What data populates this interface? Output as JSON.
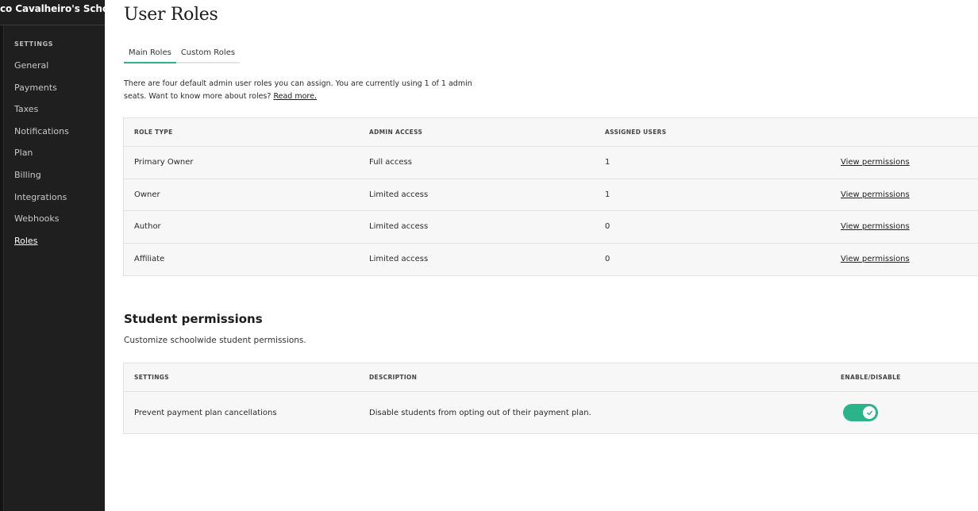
{
  "sidebar": {
    "school_name": "co Cavalheiro's School",
    "section_label": "SETTINGS",
    "items": [
      {
        "label": "General"
      },
      {
        "label": "Payments"
      },
      {
        "label": "Taxes"
      },
      {
        "label": "Notifications"
      },
      {
        "label": "Plan"
      },
      {
        "label": "Billing"
      },
      {
        "label": "Integrations"
      },
      {
        "label": "Webhooks"
      },
      {
        "label": "Roles"
      }
    ],
    "active_item": "Roles"
  },
  "main": {
    "title": "User Roles",
    "tabs": [
      {
        "label": "Main Roles",
        "active": true
      },
      {
        "label": "Custom Roles",
        "active": false
      }
    ],
    "intro_text": "There are four default admin user roles you can assign. You are currently using 1 of 1 admin seats. Want to know more about roles?",
    "intro_link": "Read more.",
    "roles_table": {
      "headers": [
        "ROLE TYPE",
        "ADMIN ACCESS",
        "ASSIGNED USERS",
        ""
      ],
      "rows": [
        {
          "role": "Primary Owner",
          "access": "Full access",
          "users": "1",
          "action": "View permissions"
        },
        {
          "role": "Owner",
          "access": "Limited access",
          "users": "1",
          "action": "View permissions"
        },
        {
          "role": "Author",
          "access": "Limited access",
          "users": "0",
          "action": "View permissions"
        },
        {
          "role": "Affiliate",
          "access": "Limited access",
          "users": "0",
          "action": "View permissions"
        }
      ]
    },
    "student_permissions": {
      "heading": "Student permissions",
      "description": "Customize schoolwide student permissions.",
      "headers": [
        "SETTINGS",
        "DESCRIPTION",
        "ENABLE/DISABLE"
      ],
      "rows": [
        {
          "setting": "Prevent payment plan cancellations",
          "description": "Disable students from opting out of their payment plan.",
          "enabled": true,
          "toggle_icon": "check-icon"
        }
      ]
    }
  },
  "colors": {
    "sidebar_bg": "#1f1f1f",
    "accent": "#2bb389",
    "table_bg": "#f7f7f7"
  }
}
